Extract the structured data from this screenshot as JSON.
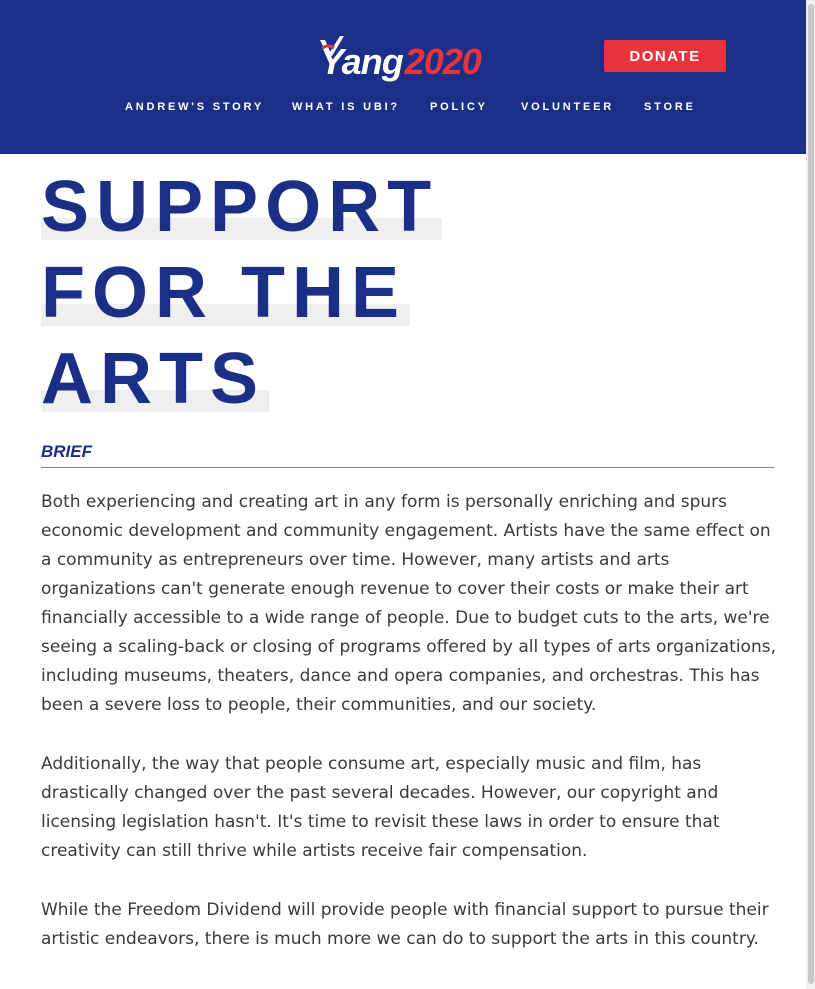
{
  "header": {
    "logo": {
      "name": "Yang",
      "year": "2020"
    },
    "donate_label": "DONATE",
    "nav": [
      {
        "label": "ANDREW'S STORY"
      },
      {
        "label": "WHAT IS UBI?"
      },
      {
        "label": "POLICY"
      },
      {
        "label": "VOLUNTEER"
      },
      {
        "label": "STORE"
      }
    ]
  },
  "main": {
    "title_lines": [
      "SUPPORT",
      "FOR THE",
      "ARTS"
    ],
    "section_label": "BRIEF",
    "paragraphs": [
      "Both experiencing and creating art in any form is personally enriching and spurs economic development and community engagement. Artists have the same effect on a community as entrepreneurs over time. However, many artists and arts organizations can't generate enough revenue to cover their costs or make their art financially accessible to a wide range of people. Due to budget cuts to the arts, we're seeing a scaling-back or closing of programs offered by all types of arts organizations, including museums, theaters, dance and opera companies, and orchestras. This has been a severe loss to people, their communities, and our society.",
      "Additionally, the way that people consume art, especially music and film, has drastically changed over the past several decades. However, our copyright and licensing legislation hasn't. It's time to revisit these laws in order to ensure that creativity can still thrive while artists receive fair compensation.",
      "While the Freedom Dividend will provide people with financial support to pursue their artistic endeavors, there is much more we can do to support the arts in this country."
    ]
  },
  "colors": {
    "brand_navy": "#1b2f86",
    "brand_red": "#e8343f",
    "body_text": "#3a3a3a"
  },
  "icons": {
    "logo_mark": "checkmark-flag-icon"
  }
}
